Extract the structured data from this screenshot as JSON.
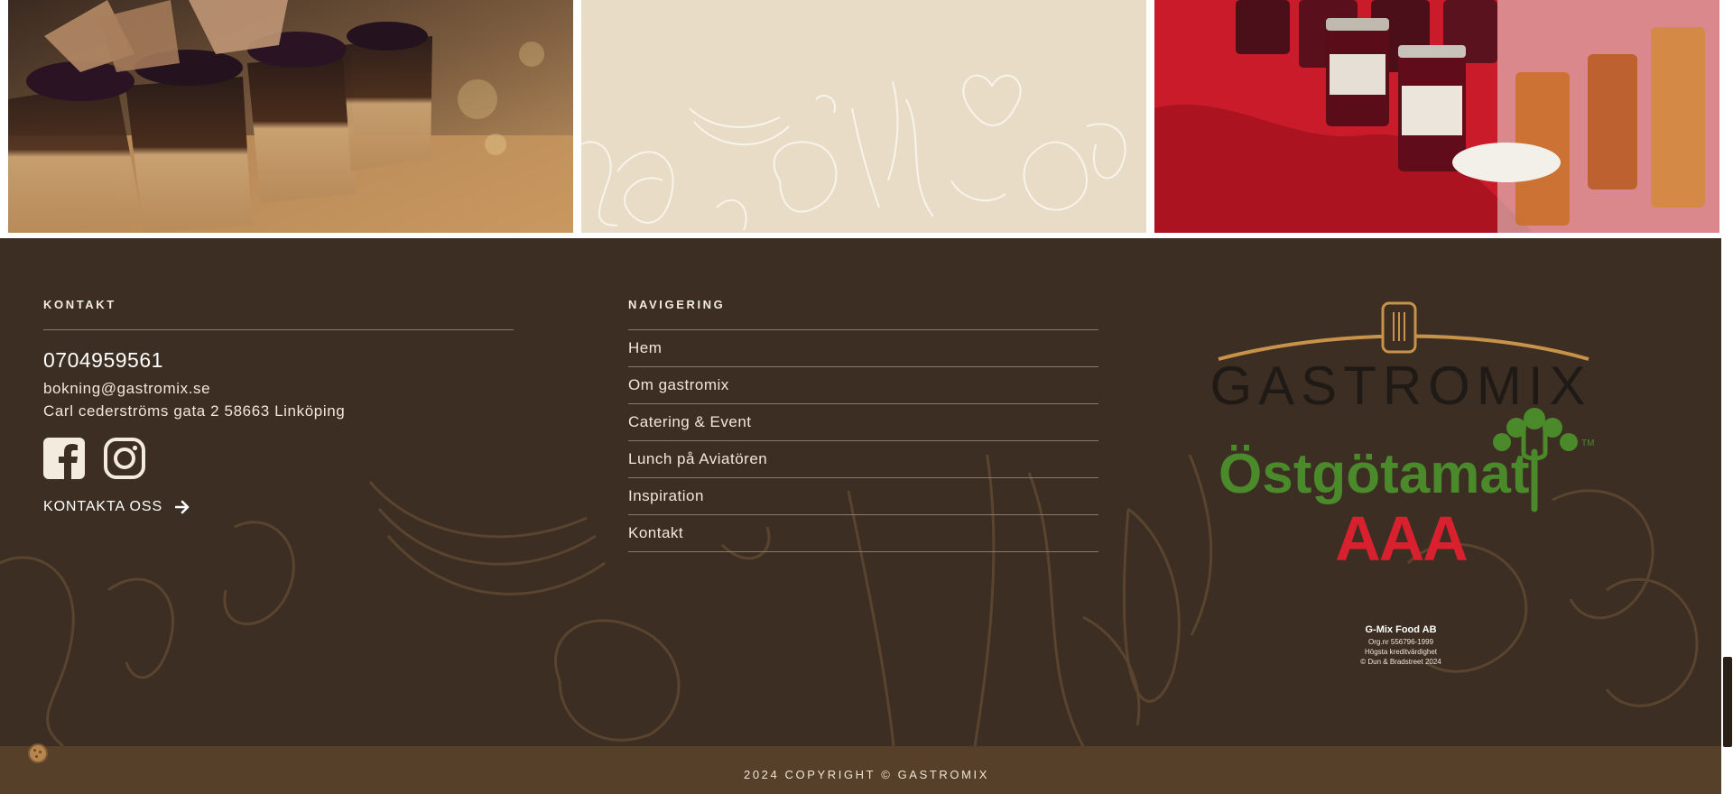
{
  "colors": {
    "footer_bg": "#3c2e22",
    "copy_bar_bg": "#56402a",
    "accent_gold": "#c8924a",
    "ostgota_green": "#4a8a2a",
    "aaa_red": "#d9202e"
  },
  "gallery": {
    "images": [
      {
        "name": "dessert-cups-image",
        "alt": "Dessert glasses with berries"
      },
      {
        "name": "vegetable-line-art-image",
        "alt": "Line drawing of vegetables"
      },
      {
        "name": "jam-jars-image",
        "alt": "Jam jars on red table"
      }
    ]
  },
  "contact": {
    "heading": "KONTAKT",
    "phone": "0704959561",
    "email": "bokning@gastromix.se",
    "address": "Carl cederströms gata 2 58663 Linköping",
    "social_icons": [
      "facebook-icon",
      "instagram-icon"
    ],
    "cta_label": "KONTAKTA OSS",
    "cta_icon": "arrow-right-icon"
  },
  "nav": {
    "heading": "NAVIGERING",
    "items": [
      "Hem",
      "Om gastromix",
      "Catering & Event",
      "Lunch på Aviatören",
      "Inspiration",
      "Kontakt"
    ]
  },
  "logos": {
    "gastromix": "GASTROMIX",
    "ostgotamat": "Östgötamat",
    "ostgotamat_tm": "TM",
    "aaa": "AAA",
    "aaa_company": "G-Mix Food AB",
    "aaa_org": "Org.nr 556796-1999",
    "aaa_rating": "Högsta kreditvärdighet",
    "aaa_source": "© Dun & Bradstreet 2024"
  },
  "copyright": "2024 COPYRIGHT © GASTROMIX"
}
